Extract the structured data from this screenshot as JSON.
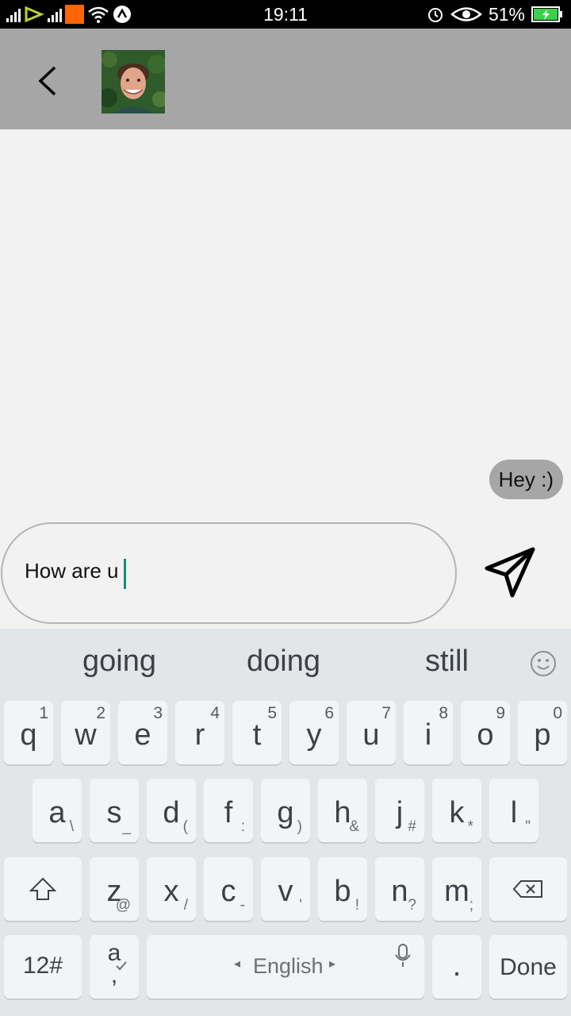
{
  "status": {
    "time": "19:11",
    "battery": "51%"
  },
  "header": {
    "back_icon": "chevron-left-icon",
    "avatar_alt": "contact-avatar"
  },
  "messages": [
    {
      "text": "Hey :)",
      "from": "me"
    }
  ],
  "composer": {
    "text": "How are u"
  },
  "keyboard": {
    "suggestions": [
      "going",
      "doing",
      "still"
    ],
    "row1": [
      {
        "k": "q",
        "h": "1"
      },
      {
        "k": "w",
        "h": "2"
      },
      {
        "k": "e",
        "h": "3"
      },
      {
        "k": "r",
        "h": "4"
      },
      {
        "k": "t",
        "h": "5"
      },
      {
        "k": "y",
        "h": "6"
      },
      {
        "k": "u",
        "h": "7"
      },
      {
        "k": "i",
        "h": "8"
      },
      {
        "k": "o",
        "h": "9"
      },
      {
        "k": "p",
        "h": "0"
      }
    ],
    "row2": [
      {
        "k": "a",
        "s": "\\"
      },
      {
        "k": "s",
        "s": "_"
      },
      {
        "k": "d",
        "s": "("
      },
      {
        "k": "f",
        "s": ":"
      },
      {
        "k": "g",
        "s": ")"
      },
      {
        "k": "h",
        "s": "&"
      },
      {
        "k": "j",
        "s": "#"
      },
      {
        "k": "k",
        "s": "*"
      },
      {
        "k": "l",
        "s": "\""
      }
    ],
    "row3": [
      {
        "k": "z",
        "s": "@"
      },
      {
        "k": "x",
        "s": "/"
      },
      {
        "k": "c",
        "s": "-"
      },
      {
        "k": "v",
        "s": "'"
      },
      {
        "k": "b",
        "s": "!"
      },
      {
        "k": "n",
        "s": "?"
      },
      {
        "k": "m",
        "s": ";"
      }
    ],
    "numbers_label": "12#",
    "lang_key": {
      "k": "a",
      "s": ","
    },
    "space_label": "English",
    "period_label": ".",
    "done_label": "Done"
  },
  "colors": {
    "header_bg": "#a6a6a6",
    "bubble_bg": "#a6a6a6",
    "caret": "#1a8a7a",
    "keyboard_bg": "#e3e6e8"
  }
}
